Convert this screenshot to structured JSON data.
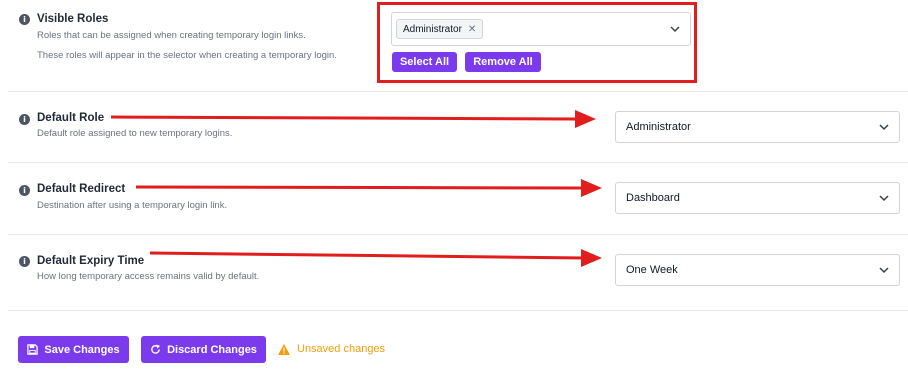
{
  "settings": [
    {
      "label": "Visible Roles",
      "description_lines": [
        "Roles that can be assigned when creating temporary login links.",
        "These roles will appear in the selector when creating a temporary login."
      ],
      "selected_tags": [
        "Administrator"
      ],
      "select_all_label": "Select All",
      "remove_all_label": "Remove All"
    },
    {
      "label": "Default Role",
      "description": "Default role assigned to new temporary logins.",
      "value": "Administrator"
    },
    {
      "label": "Default Redirect",
      "description": "Destination after using a temporary login link.",
      "value": "Dashboard"
    },
    {
      "label": "Default Expiry Time",
      "description": "How long temporary access remains valid by default.",
      "value": "One Week"
    }
  ],
  "footer": {
    "save_label": "Save Changes",
    "discard_label": "Discard Changes",
    "unsaved_label": "Unsaved changes"
  },
  "colors": {
    "accent": "#7c3aed",
    "annotation": "#e11d1d",
    "warning": "#f59e0b"
  },
  "icons": [
    "info-icon",
    "chevron-down-icon",
    "close-icon",
    "save-icon",
    "refresh-icon",
    "warning-icon",
    "arrow-annotation"
  ]
}
